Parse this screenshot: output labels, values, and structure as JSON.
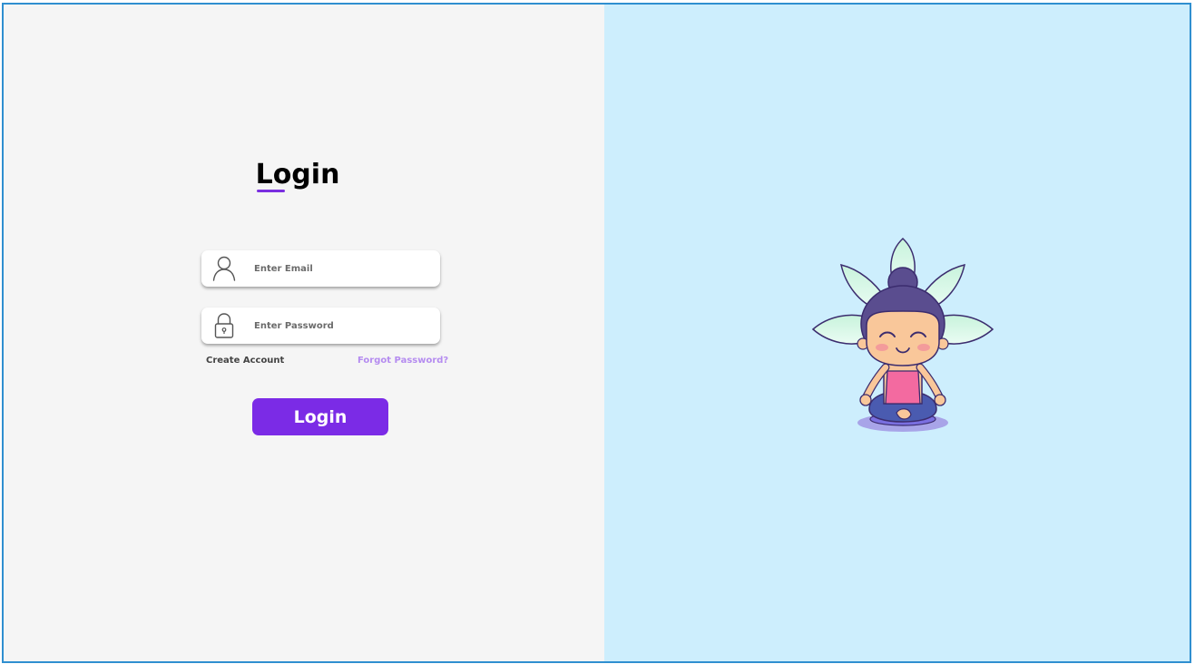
{
  "login_form": {
    "title": "Login",
    "email": {
      "value": "",
      "placeholder": "Enter Email",
      "icon": "user-icon"
    },
    "password": {
      "value": "",
      "placeholder": "Enter Password",
      "icon": "lock-icon"
    },
    "create_account_label": "Create Account",
    "forgot_password_label": "Forgot Password?",
    "submit_label": "Login"
  },
  "illustration": {
    "subject": "meditating-girl-illustration"
  },
  "colors": {
    "accent": "#7b2be6",
    "accent_light": "#b58cf0",
    "left_background": "#f5f5f5",
    "right_background": "#cdeefd",
    "frame_border": "#2f8fd0"
  }
}
